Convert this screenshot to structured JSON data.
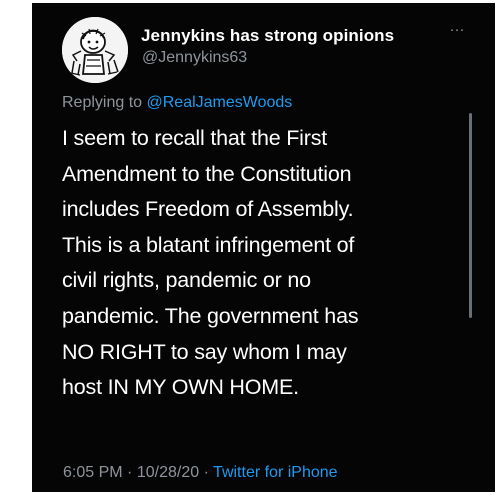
{
  "author": {
    "display_name": "Jennykins has strong opinions",
    "handle": "@Jennykins63",
    "avatar_icon": "cartoon-avatar-icon"
  },
  "more_icon": {
    "glyph": "···",
    "name": "more-options-icon"
  },
  "reply": {
    "prefix": "Replying to",
    "mention": "@RealJamesWoods"
  },
  "tweet_lines": [
    "I seem to recall that the First",
    "Amendment to the Constitution",
    "includes Freedom of Assembly.",
    "This is a blatant infringement of",
    "civil rights, pandemic or no",
    "pandemic.  The government has",
    "NO RIGHT to say whom I may",
    "host IN MY OWN HOME."
  ],
  "meta": {
    "time": "6:05 PM",
    "separator": "·",
    "date": "10/28/20",
    "source": "Twitter for iPhone"
  },
  "colors": {
    "background": "#050505",
    "text": "#ffffff",
    "muted": "#8e949b",
    "link": "#1d9bf0"
  }
}
